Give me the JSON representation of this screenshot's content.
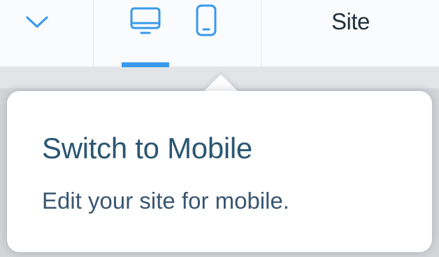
{
  "toolbar": {
    "collapse_icon": "chevron-down-icon",
    "devices": [
      {
        "name": "desktop",
        "icon": "desktop-icon",
        "active": true
      },
      {
        "name": "mobile",
        "icon": "mobile-icon",
        "active": false
      }
    ],
    "site_label": "Site"
  },
  "popover": {
    "title": "Switch to Mobile",
    "text": "Edit your site for mobile."
  },
  "colors": {
    "accent": "#3899ec",
    "title": "#2b5672",
    "text": "#395671",
    "toolbar_bg": "#fafbfc",
    "canvas_bg": "#d4d6d9"
  }
}
